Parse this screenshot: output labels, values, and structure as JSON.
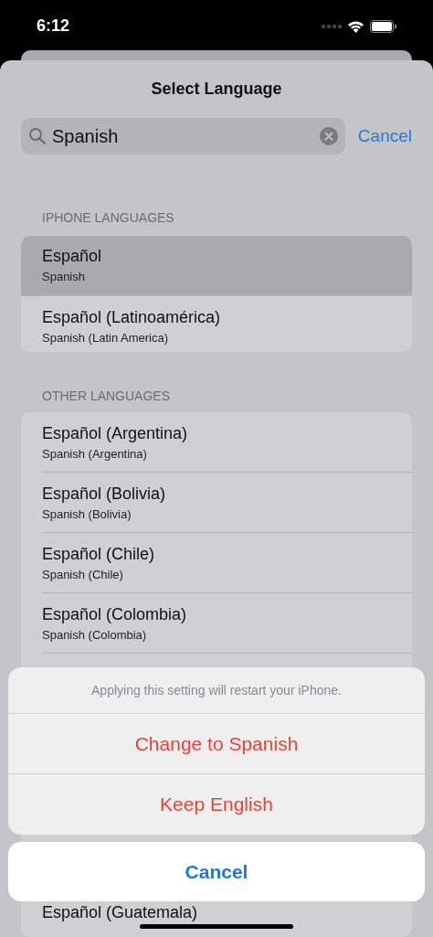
{
  "status_bar": {
    "time": "6:12"
  },
  "title": "Select Language",
  "search": {
    "value": "Spanish",
    "cancel": "Cancel"
  },
  "sections": [
    {
      "header": "IPHONE LANGUAGES",
      "rows": [
        {
          "kind": "language",
          "name": "Español",
          "subtitle": "Spanish",
          "selected": true
        },
        {
          "kind": "language",
          "name": "Español (Latinoamérica)",
          "subtitle": "Spanish (Latin America)",
          "selected": false
        }
      ]
    },
    {
      "header": "OTHER LANGUAGES",
      "rows": [
        {
          "kind": "language",
          "name": "Español (Argentina)",
          "subtitle": "Spanish (Argentina)",
          "selected": false
        },
        {
          "kind": "language",
          "name": "Español (Bolivia)",
          "subtitle": "Spanish (Bolivia)",
          "selected": false
        },
        {
          "kind": "language",
          "name": "Español (Chile)",
          "subtitle": "Spanish (Chile)",
          "selected": false
        },
        {
          "kind": "language",
          "name": "Español (Colombia)",
          "subtitle": "Spanish (Colombia)",
          "selected": false
        },
        {
          "kind": "covered"
        },
        {
          "kind": "covered"
        },
        {
          "kind": "covered"
        },
        {
          "kind": "covered"
        },
        {
          "kind": "language",
          "name": "Español (Guatemala)",
          "selected": false
        }
      ]
    }
  ],
  "action_sheet": {
    "message": "Applying this setting will restart your iPhone.",
    "actions": [
      "Change to Spanish",
      "Keep English"
    ],
    "cancel": "Cancel"
  }
}
